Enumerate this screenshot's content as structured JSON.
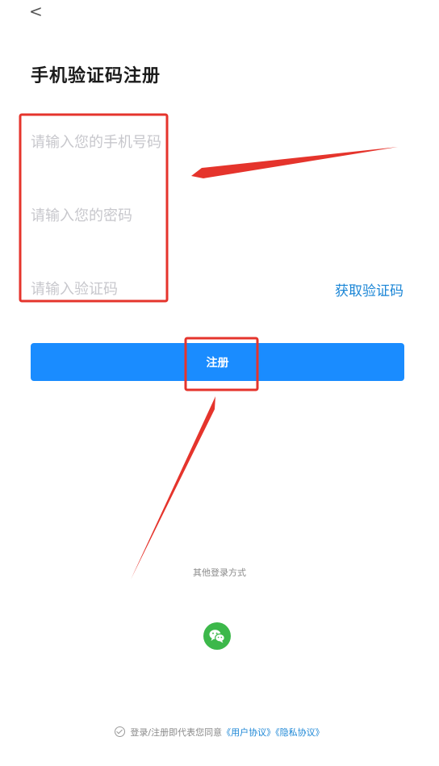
{
  "header": {
    "back_icon": "chevron-left-icon",
    "back_glyph": "<",
    "title": "手机验证码注册"
  },
  "form": {
    "phone_placeholder": "请输入您的手机号码",
    "password_placeholder": "请输入您的密码",
    "code_placeholder": "请输入验证码",
    "get_code_label": "获取验证码",
    "submit_label": "注册"
  },
  "other_login": {
    "label": "其他登录方式",
    "wechat_icon": "wechat-icon"
  },
  "agreement": {
    "prefix": "登录/注册即代表您同意",
    "user_agreement": "《用户协议》",
    "privacy_agreement": "《隐私协议》"
  },
  "colors": {
    "primary": "#1a8cff",
    "link": "#1b86d6",
    "wechat": "#3cb84a",
    "annotation": "#e5342c"
  }
}
